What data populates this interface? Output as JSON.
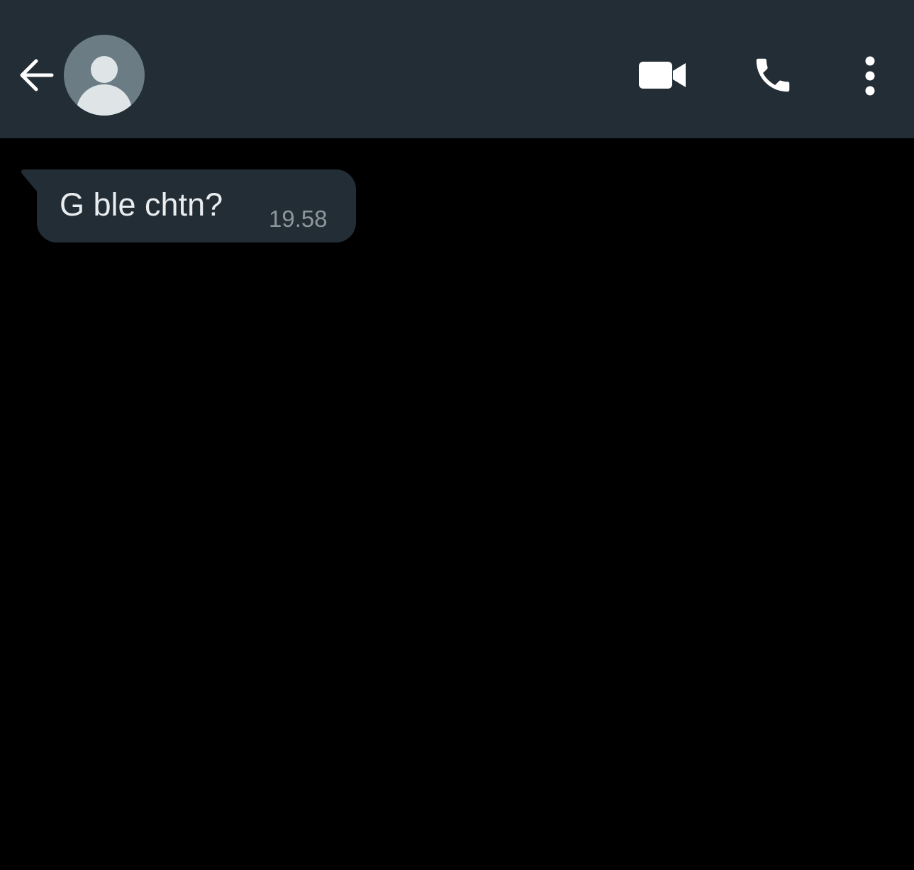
{
  "header": {
    "back_icon": "arrow-left-icon",
    "avatar_icon": "default-contact-avatar-icon",
    "actions": [
      {
        "name": "video-call",
        "icon": "video-camera-icon"
      },
      {
        "name": "voice-call",
        "icon": "phone-icon"
      },
      {
        "name": "more-options",
        "icon": "vertical-dots-icon"
      }
    ]
  },
  "messages": [
    {
      "direction": "incoming",
      "text": "G ble chtn?",
      "time": "19.58"
    }
  ],
  "colors": {
    "header_background": "#232d35",
    "chat_background": "#000000",
    "bubble_background": "#232d35",
    "message_text": "#e9edef",
    "timestamp_text": "#8d969b",
    "icon_color": "#ffffff",
    "avatar_background": "#6b7c85",
    "avatar_figure": "#dfe5e7"
  }
}
